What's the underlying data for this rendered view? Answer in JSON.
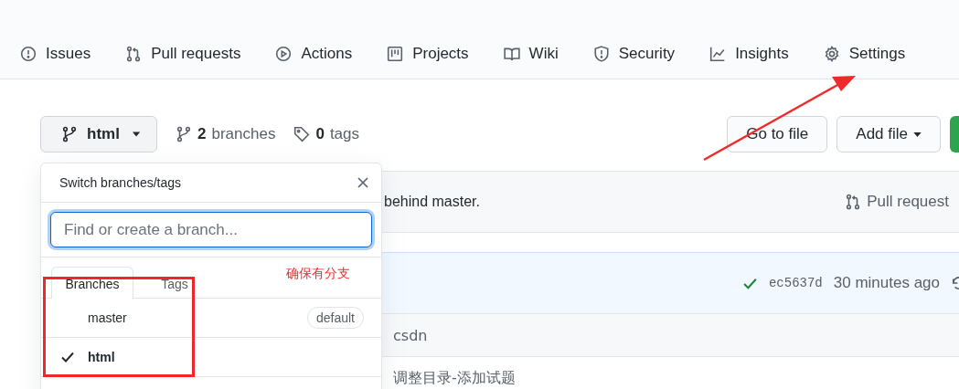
{
  "nav_tabs": [
    {
      "label": "Issues"
    },
    {
      "label": "Pull requests"
    },
    {
      "label": "Actions"
    },
    {
      "label": "Projects"
    },
    {
      "label": "Wiki"
    },
    {
      "label": "Security"
    },
    {
      "label": "Insights"
    },
    {
      "label": "Settings"
    }
  ],
  "branch_bar": {
    "branch_button": "html",
    "branch_count": "2",
    "branch_label": "branches",
    "tag_count": "0",
    "tag_label": "tags"
  },
  "actions": [
    "Go to file",
    "Add file"
  ],
  "compare_bar": {
    "text": "behind master.",
    "pull_request": "Pull request"
  },
  "latest_commit": {
    "sha": "ec5637d",
    "time": "30 minutes ago"
  },
  "files": [
    {
      "message": "csdn"
    },
    {
      "message": "调整目录-添加试题"
    }
  ],
  "branch_menu": {
    "title": "Switch branches/tags",
    "search": {
      "placeholder": "Find or create a branch..."
    },
    "tabs": [
      {
        "label": "Branches",
        "selected": true
      },
      {
        "label": "Tags",
        "selected": false
      }
    ],
    "branches": [
      {
        "name": "master",
        "checked": false,
        "badge": "default"
      },
      {
        "name": "html",
        "checked": true
      }
    ]
  },
  "annotation": {
    "note": "确保有分支"
  }
}
